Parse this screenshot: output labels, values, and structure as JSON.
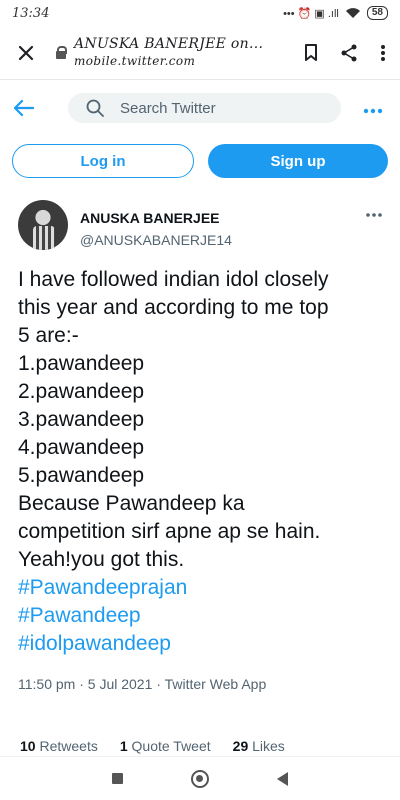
{
  "status_bar": {
    "time": "13:34",
    "icons": "••• ⏰ ▣ .ıll",
    "battery": "58"
  },
  "browser": {
    "page_title": "ANUSKA BANERJEE on...",
    "url": "mobile.twitter.com"
  },
  "header": {
    "search_placeholder": "Search Twitter"
  },
  "auth": {
    "login_label": "Log in",
    "signup_label": "Sign up"
  },
  "tweet": {
    "display_name": "ANUSKA BANERJEE",
    "handle": "@ANUSKABANERJE14",
    "lines": [
      "I have followed indian idol closely",
      "this year and according to me top",
      "5 are:-",
      "1.pawandeep",
      "2.pawandeep",
      "3.pawandeep",
      "4.pawandeep",
      "5.pawandeep",
      "Because Pawandeep ka",
      "competition sirf apne ap se hain.",
      "Yeah!you got this."
    ],
    "hashtags": [
      "#Pawandeeprajan",
      "#Pawandeep",
      "#idolpawandeep"
    ],
    "meta": "11:50 pm · 5 Jul 2021 · Twitter Web App",
    "stats": {
      "retweets_count": "10",
      "retweets_label": "Retweets",
      "quotes_count": "1",
      "quotes_label": "Quote Tweet",
      "likes_count": "29",
      "likes_label": "Likes"
    }
  },
  "colors": {
    "accent": "#1d9bf0",
    "text_primary": "#0f1419",
    "text_secondary": "#536471"
  }
}
